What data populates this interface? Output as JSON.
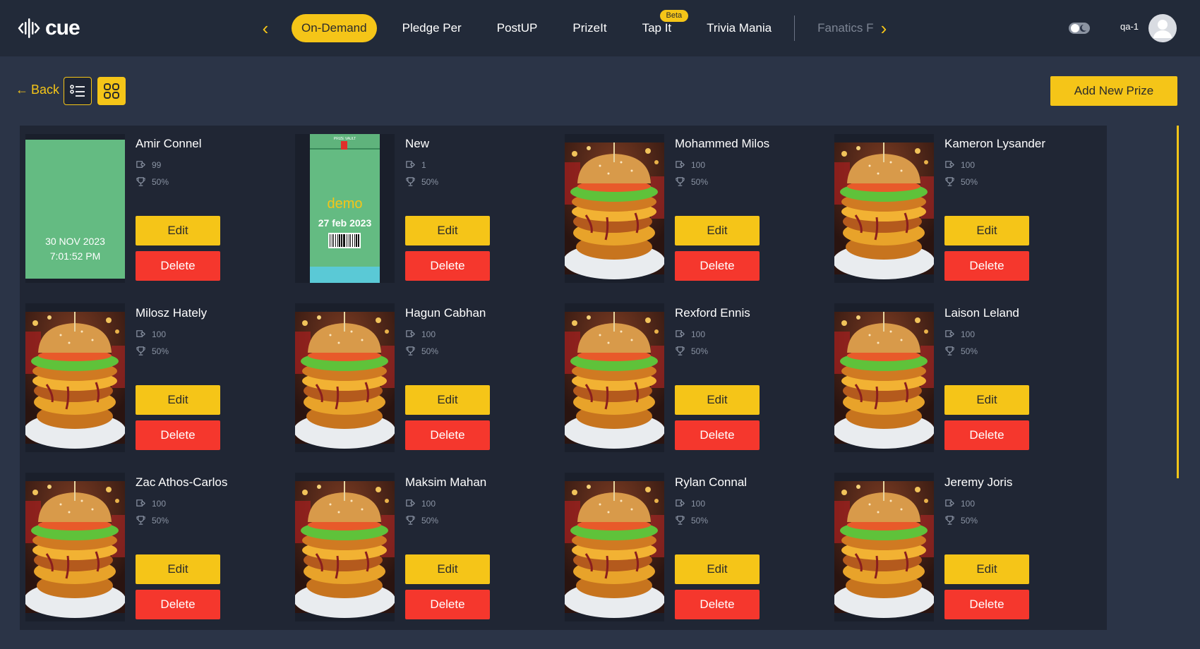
{
  "app": {
    "logo_text": "cue",
    "user": "qa-1"
  },
  "nav": {
    "tabs": [
      {
        "label": "On-Demand",
        "active": true
      },
      {
        "label": "Pledge Per"
      },
      {
        "label": "PostUP"
      },
      {
        "label": "PrizeIt"
      },
      {
        "label": "Tap It",
        "badge": "Beta"
      },
      {
        "label": "Trivia Mania"
      },
      {
        "label": "Fanatics F",
        "muted": true
      }
    ]
  },
  "toolbar": {
    "back_label": "Back",
    "add_label": "Add New Prize"
  },
  "colors": {
    "accent": "#f5c518",
    "danger": "#f5372d",
    "bg": "#2b3447",
    "card": "#202634",
    "green_tile": "#64bb82"
  },
  "buttons": {
    "edit": "Edit",
    "delete": "Delete"
  },
  "prizes": [
    {
      "name": "Amir Connel",
      "count": "99",
      "percent": "50%",
      "image": "green-date",
      "date": "30 NOV 2023",
      "time": "7:01:52 PM"
    },
    {
      "name": "New",
      "count": "1",
      "percent": "50%",
      "image": "demo-card",
      "demo_header": "PRIZE VAULT",
      "demo_word": "demo",
      "date": "27 feb 2023"
    },
    {
      "name": "Mohammed Milos",
      "count": "100",
      "percent": "50%",
      "image": "burger"
    },
    {
      "name": "Kameron Lysander",
      "count": "100",
      "percent": "50%",
      "image": "burger"
    },
    {
      "name": "Milosz Hately",
      "count": "100",
      "percent": "50%",
      "image": "burger"
    },
    {
      "name": "Hagun Cabhan",
      "count": "100",
      "percent": "50%",
      "image": "burger"
    },
    {
      "name": "Rexford Ennis",
      "count": "100",
      "percent": "50%",
      "image": "burger"
    },
    {
      "name": "Laison Leland",
      "count": "100",
      "percent": "50%",
      "image": "burger"
    },
    {
      "name": "Zac Athos-Carlos",
      "count": "100",
      "percent": "50%",
      "image": "burger"
    },
    {
      "name": "Maksim Mahan",
      "count": "100",
      "percent": "50%",
      "image": "burger"
    },
    {
      "name": "Rylan Connal",
      "count": "100",
      "percent": "50%",
      "image": "burger"
    },
    {
      "name": "Jeremy Joris",
      "count": "100",
      "percent": "50%",
      "image": "burger"
    }
  ]
}
